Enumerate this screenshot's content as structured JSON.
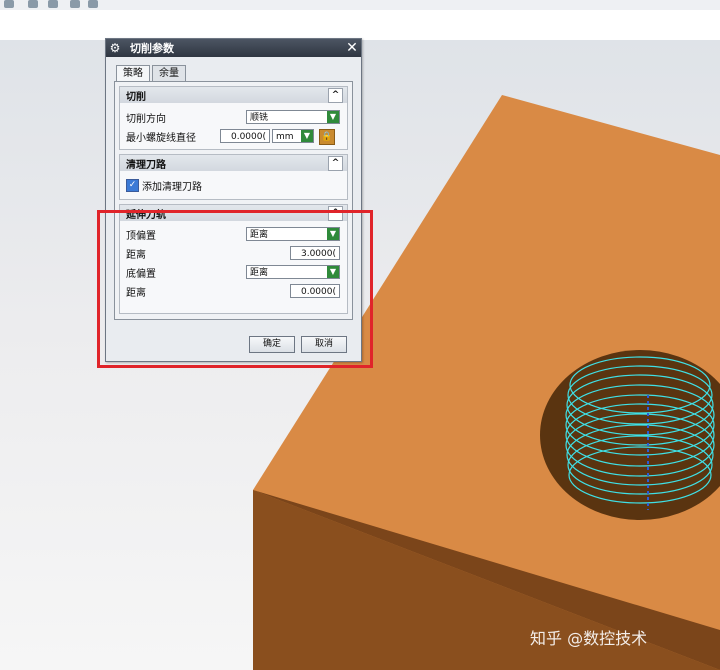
{
  "toolbar": {
    "icons": [
      "undo-icon",
      "window-icon",
      "dropdown-icon",
      "sphere-icon",
      "cube-icon"
    ]
  },
  "dialog": {
    "title": "切削参数",
    "close_symbol": "✕",
    "tabs": [
      {
        "label": "策略"
      },
      {
        "label": "余量"
      }
    ],
    "sections": {
      "cut": {
        "title": "切削",
        "caret": "^",
        "direction_label": "切削方向",
        "direction_value": "顺铣",
        "min_spiral_label": "最小螺旋线直径",
        "min_spiral_value": "0.0000(",
        "min_spiral_unit": "mm"
      },
      "cleanup": {
        "title": "清理刀路",
        "caret": "^",
        "add_cleanup_label": "添加清理刀路",
        "add_cleanup_checked": true
      },
      "extend": {
        "title": "延伸刀轨",
        "caret": "^",
        "top_offset_label": "顶偏置",
        "top_offset_value": "距离",
        "top_distance_label": "距离",
        "top_distance_value": "3.0000(",
        "bottom_offset_label": "底偏置",
        "bottom_offset_value": "距离",
        "bottom_distance_label": "距离",
        "bottom_distance_value": "0.0000("
      }
    },
    "buttons": {
      "ok": "确定",
      "cancel": "取消"
    }
  },
  "watermark": {
    "text": "知乎 @数控技术"
  },
  "colors": {
    "model_top": "#d98a45",
    "model_side": "#8a4f1e",
    "thread": "#3fe0e6",
    "highlight": "#e0242a"
  }
}
